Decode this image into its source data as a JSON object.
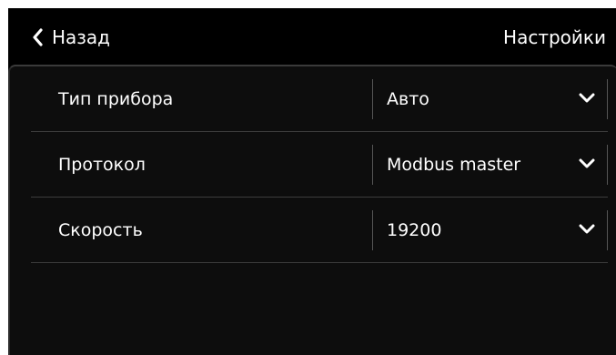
{
  "header": {
    "back_label": "Назад",
    "title": "Настройки",
    "back_icon": "chevron-left-icon"
  },
  "settings": [
    {
      "label": "Тип прибора",
      "value": "Авто",
      "icon": "chevron-down-icon"
    },
    {
      "label": "Протокол",
      "value": "Modbus master",
      "icon": "chevron-down-icon"
    },
    {
      "label": "Скорость",
      "value": "19200",
      "icon": "chevron-down-icon"
    }
  ],
  "colors": {
    "background": "#000000",
    "text": "#ffffff",
    "divider": "#3c3c3c"
  }
}
